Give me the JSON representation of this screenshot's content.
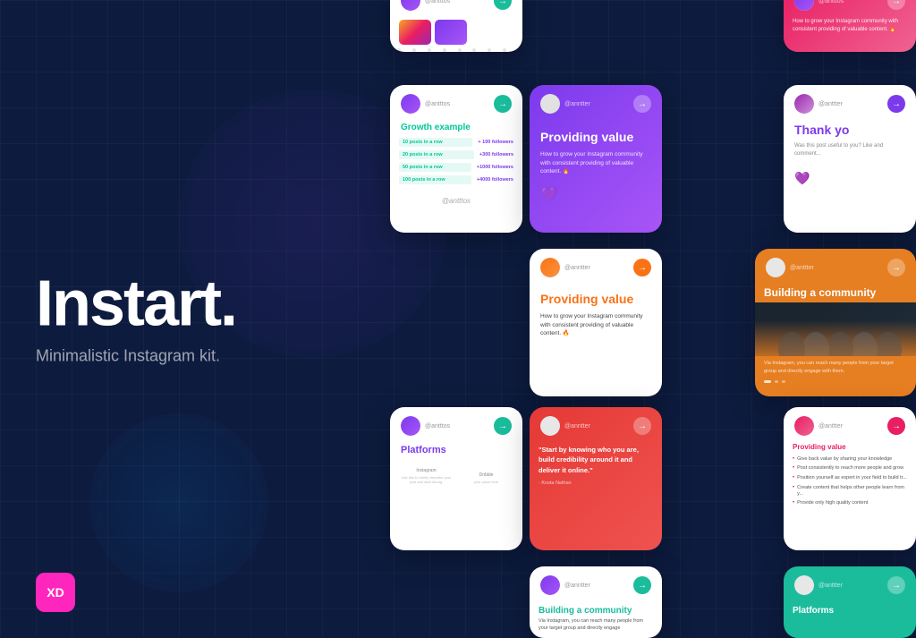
{
  "brand": {
    "title": "Instart.",
    "subtitle": "Minimalistic Instagram kit.",
    "xd_label": "XD"
  },
  "cards": {
    "growth": {
      "title": "Growth example",
      "rows": [
        {
          "label": "10 posts in a row",
          "value": "+100 followers"
        },
        {
          "label": "20 posts in a row",
          "value": "+300 followers"
        },
        {
          "label": "50 posts in a row",
          "value": "+1000 followers"
        },
        {
          "label": "100 posts in a row",
          "value": "+4000 followers"
        }
      ]
    },
    "providing_purple": {
      "title": "Providing value",
      "desc": "How to grow your Instagram community with consistent providing of valuable content. 🔥"
    },
    "thank_you": {
      "title": "Thank yo",
      "desc": "Was this post useful to you? Like and comment..."
    },
    "providing_white": {
      "title": "Providing value",
      "desc": "How to grow your Instagram community with consistent providing of valuable content. 🔥"
    },
    "building_community": {
      "title": "Building a community",
      "desc": "Via Instagram, you can reach many people from your target group and directly engage with them."
    },
    "platforms": {
      "title": "Platforms",
      "platform1": "Instagram",
      "platform2": "Dribble",
      "desc1": "Use this to briefly describe your post and start strong.",
      "desc2": "your place here"
    },
    "quote": {
      "text": "\"Start by knowing who you are, build credibility around it and deliver it online.\"",
      "author": "- Kosta Nathan"
    },
    "providing_list": {
      "title": "Providing value",
      "items": [
        "Give back value by sharing your knowledge",
        "Post consistently to reach more people and grow",
        "Position yourself as a expert in your field to build tr...",
        "Create content that helps other people learn from y...",
        "Provide only high quality content"
      ]
    },
    "building_bottom": {
      "title": "Building a community",
      "desc": "Via Instagram, you can reach many people from your target group and directly engage"
    },
    "platforms_bottom": {
      "title": "Platforms"
    },
    "top_pink": {
      "desc": "How to grow your Instagram community with consistent providing of valuable content. 🔥"
    }
  },
  "usernames": {
    "username1": "@antttos",
    "username2": "@anntter",
    "username3": "@anttter"
  }
}
